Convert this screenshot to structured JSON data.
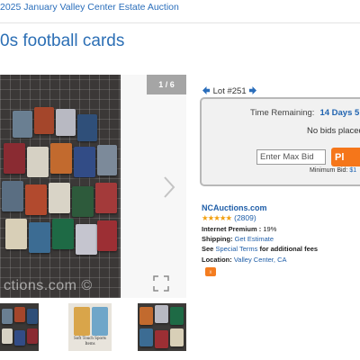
{
  "breadcrumb": {
    "text": "2025 January Valley Center Estate Auction"
  },
  "page": {
    "title": "0s football cards"
  },
  "gallery": {
    "counter": "1 / 6",
    "watermark": "ctions.com ©",
    "thumb2_caption": "Soft Touch Sports Items"
  },
  "lot": {
    "label": "Lot #251"
  },
  "bid": {
    "time_label": "Time Remaining:",
    "time_value": "14 Days 5 H",
    "status": "No bids placed",
    "input_placeholder": "Enter Max Bid",
    "button_label": "Pl",
    "min_bid_label": "Minimum Bid:",
    "min_bid_value": "$1"
  },
  "seller": {
    "name": "NCAuctions.com",
    "stars": "★★★★★",
    "rating_count": "(2809)",
    "premium_label": "Internet Premium :",
    "premium_value": "19%",
    "shipping_label": "Shipping:",
    "shipping_value": "Get Estimate",
    "terms_prefix": "See",
    "terms_link": "Special Terms",
    "terms_suffix": "for additional fees",
    "location_label": "Location:",
    "location_value": "Valley Center, CA"
  },
  "colors": {
    "accent": "#2c6fb5",
    "bid_button": "#f5761a",
    "stars": "#f2a010"
  }
}
